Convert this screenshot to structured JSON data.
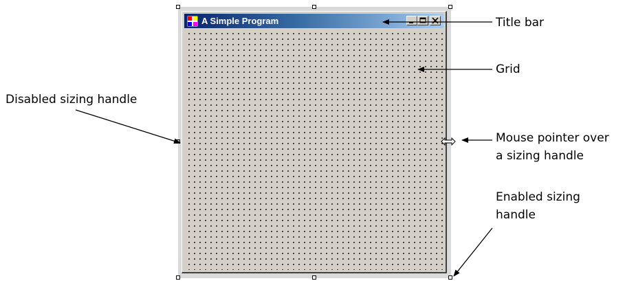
{
  "window": {
    "title": "A Simple Program",
    "buttons": {
      "minimize": "minimize",
      "maximize": "maximize",
      "close": "close"
    }
  },
  "callouts": {
    "title_bar": "Title bar",
    "grid": "Grid",
    "disabled_handle": "Disabled sizing handle",
    "mouse_pointer_line1": "Mouse pointer over",
    "mouse_pointer_line2": "a sizing handle",
    "enabled_handle_line1": "Enabled sizing",
    "enabled_handle_line2": "handle"
  },
  "colors": {
    "titlebar_start": "#0a246a",
    "titlebar_end": "#a6caf0",
    "form_background": "#d4d0c8",
    "grid_dot": "#000000"
  }
}
